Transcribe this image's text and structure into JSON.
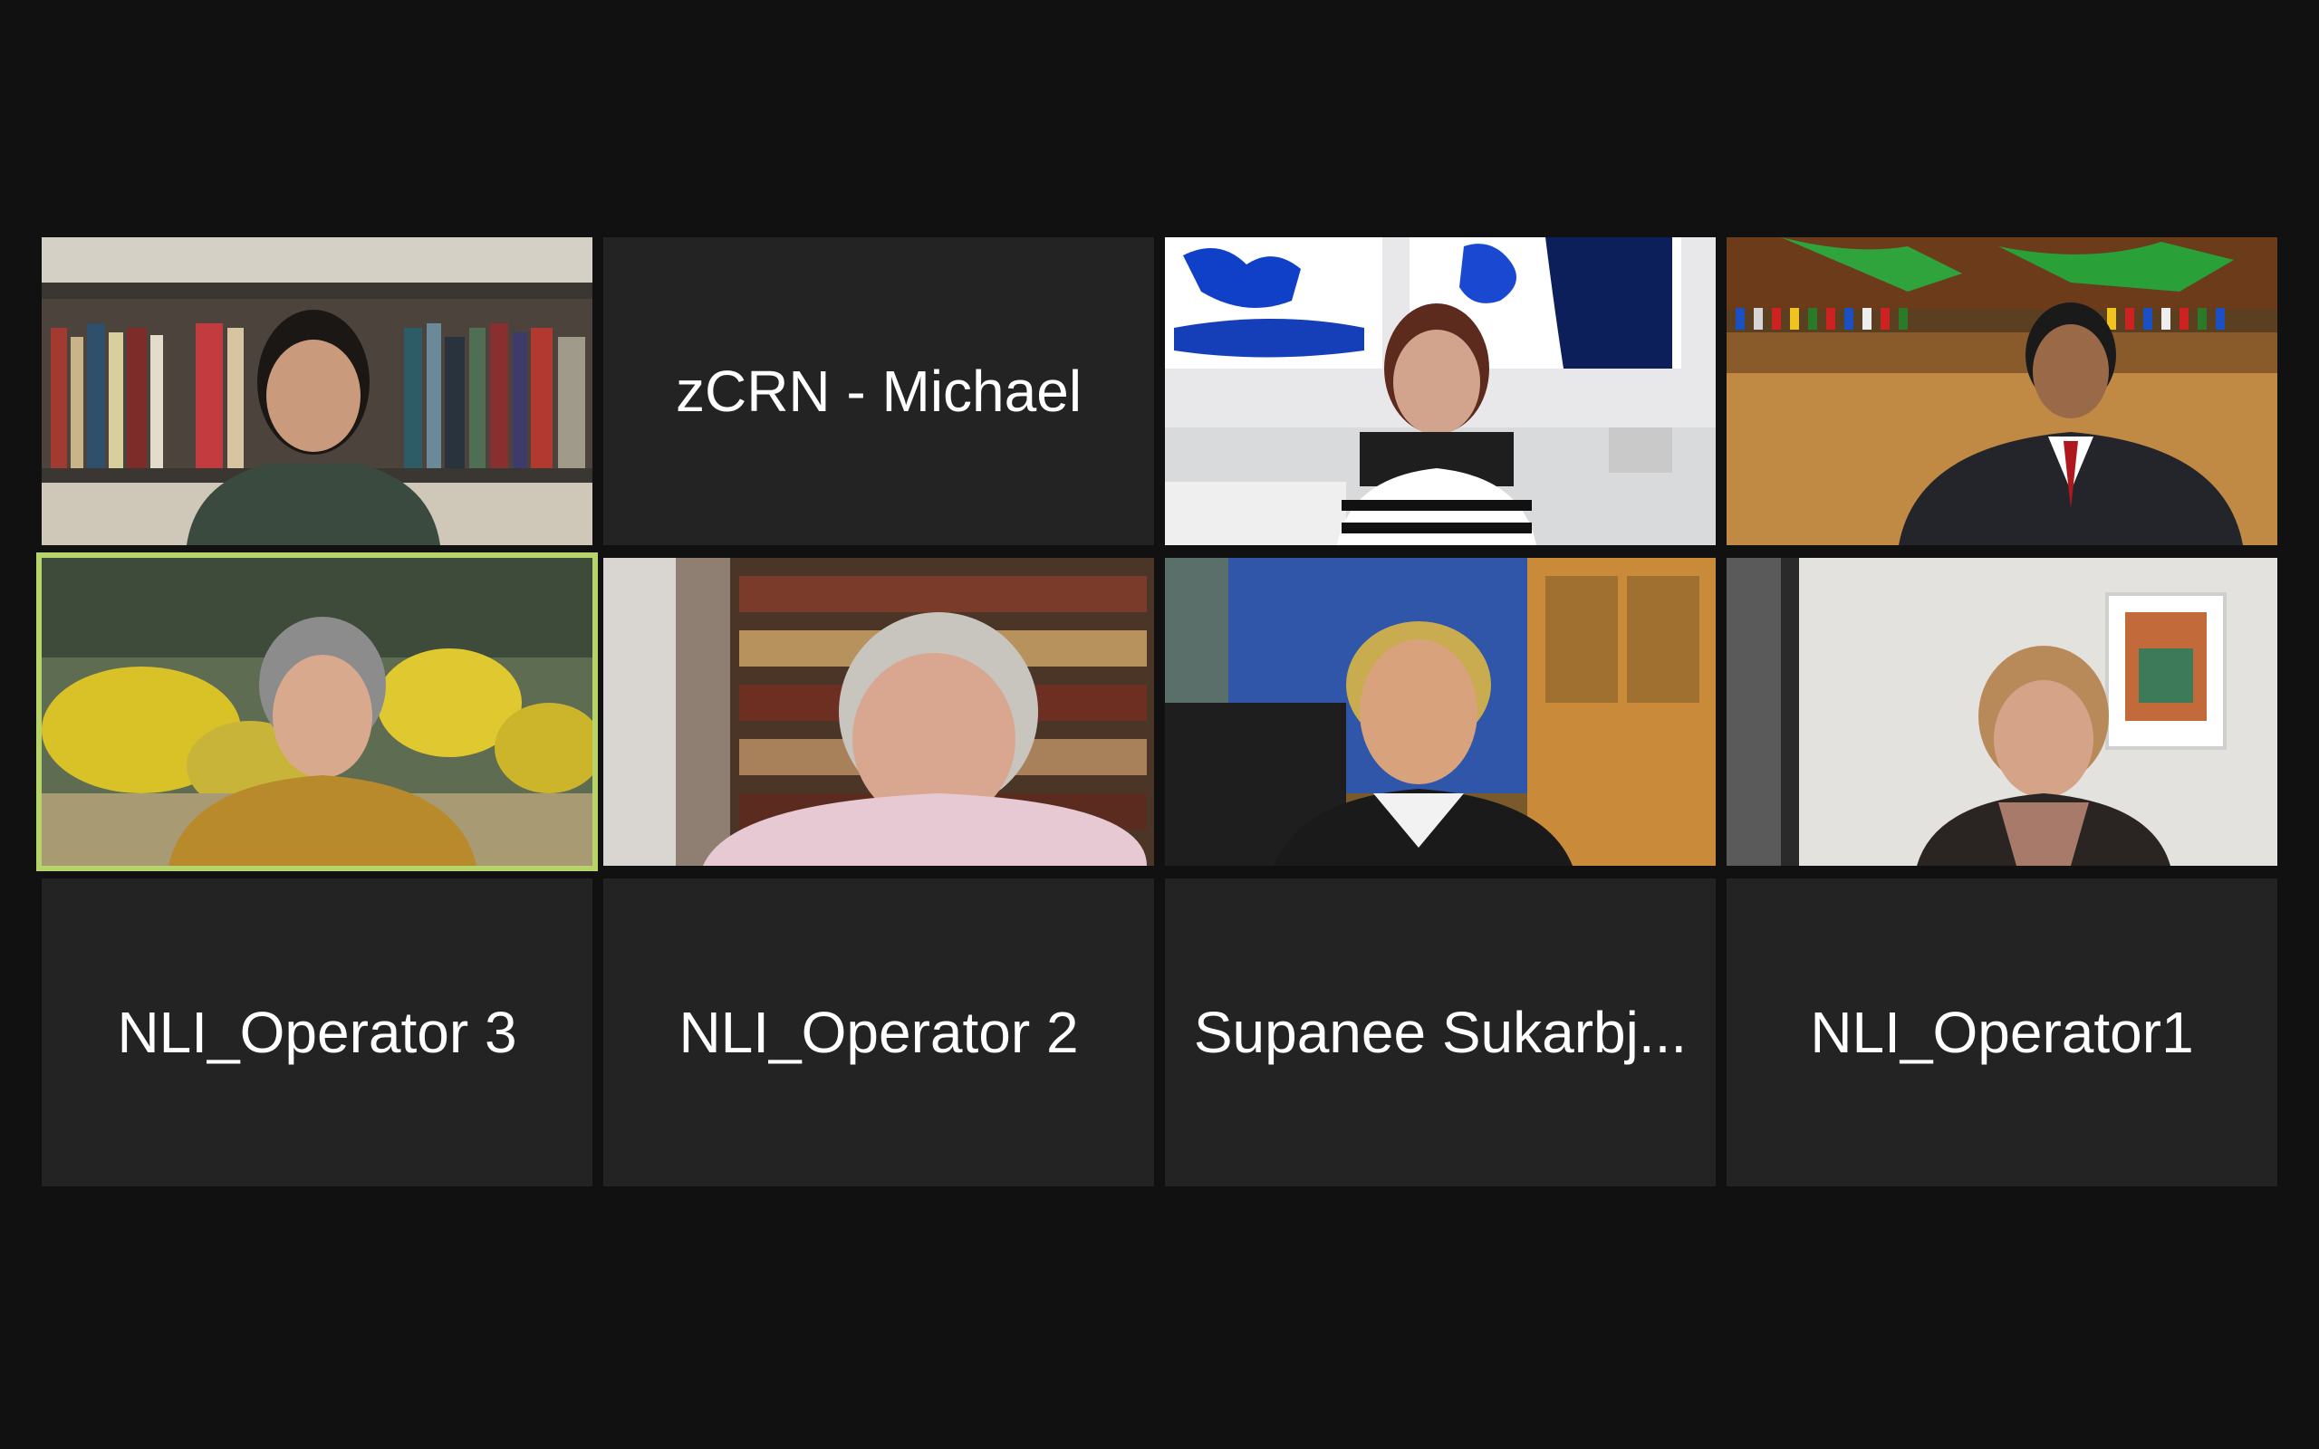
{
  "meeting": {
    "participants": [
      {
        "id": "p1",
        "type": "video"
      },
      {
        "id": "p2",
        "type": "name",
        "name": "zCRN - Michael"
      },
      {
        "id": "p3",
        "type": "video"
      },
      {
        "id": "p4",
        "type": "video"
      },
      {
        "id": "p5",
        "type": "video",
        "active_speaker": true
      },
      {
        "id": "p6",
        "type": "video"
      },
      {
        "id": "p7",
        "type": "video"
      },
      {
        "id": "p8",
        "type": "video"
      },
      {
        "id": "p9",
        "type": "name",
        "name": "NLI_Operator 3"
      },
      {
        "id": "p10",
        "type": "name",
        "name": "NLI_Operator 2"
      },
      {
        "id": "p11",
        "type": "name",
        "name": "Supanee Sukarbj..."
      },
      {
        "id": "p12",
        "type": "name",
        "name": "NLI_Operator1"
      }
    ],
    "colors": {
      "background": "#111111",
      "tile": "#232323",
      "active_speaker_border": "#b7d46a",
      "name_text": "#ffffff"
    }
  }
}
